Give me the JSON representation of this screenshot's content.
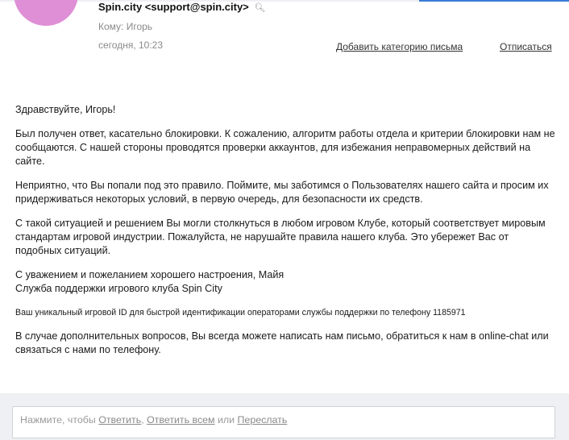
{
  "header": {
    "sender": "Spin.city <support@spin.city>",
    "search_icon": "search-icon",
    "to": "Кому: Игорь",
    "date": "сегодня, 10:23",
    "add_category": "Добавить категорию письма",
    "unsubscribe": "Отписаться",
    "avatar_color": "#df8fd6"
  },
  "message": {
    "greeting": "Здравствуйте, Игорь!",
    "p1": "Был получен ответ, касательно блокировки. К сожалению, алгоритм работы отдела и критерии блокировки нам не сообщаются. С нашей стороны проводятся проверки аккаунтов, для избежания неправомерных действий на сайте.",
    "p2": "Неприятно, что Вы попали под это правило. Поймите, мы заботимся о Пользователях нашего сайта и просим их придерживаться некоторых условий, в первую очередь, для безопасности их средств.",
    "p3": "С такой ситуацией и решением Вы могли столкнуться в любом игровом Клубе, который соответствует мировым стандартам игровой индустрии. Пожалуйста, не нарушайте правила нашего клуба. Это убережет Вас от подобных ситуаций.",
    "sign1": "С уважением и пожеланием хорошего настроения, Майя",
    "sign2": "Служба поддержки игрового клуба Spin City",
    "id_note": "Ваш уникальный игровой ID для быстрой идентификации операторами службы поддержки по телефону 1185971",
    "p4": "В случае дополнительных вопросов, Вы всегда можете написать нам письмо, обратиться к нам в online-chat или связаться с нами по телефону."
  },
  "reply": {
    "prefix": "Нажмите, чтобы",
    "reply": "Ответить",
    "sep1": ",",
    "reply_all": "Ответить всем",
    "or": "или",
    "forward": "Переслать"
  }
}
